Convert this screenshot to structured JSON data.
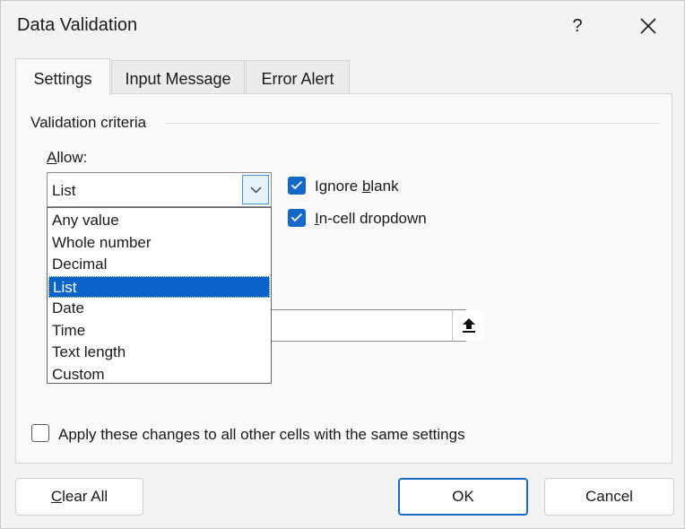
{
  "window": {
    "title": "Data Validation",
    "help_label": "?",
    "close_icon": "close-icon"
  },
  "tabs": [
    {
      "label": "Settings",
      "active": true
    },
    {
      "label": "Input Message",
      "active": false
    },
    {
      "label": "Error Alert",
      "active": false
    }
  ],
  "settings": {
    "group_label": "Validation criteria",
    "allow_label_underlined": "A",
    "allow_label_rest": "llow:",
    "allow_selected": "List",
    "allow_options": [
      "Any value",
      "Whole number",
      "Decimal",
      "List",
      "Date",
      "Time",
      "Text length",
      "Custom"
    ],
    "ignore_blank": {
      "pre": "Ignore ",
      "underlined": "b",
      "post": "lank",
      "checked": true
    },
    "incell_dropdown": {
      "pre": "",
      "underlined": "I",
      "post": "n-cell dropdown",
      "checked": true
    },
    "source_value": "",
    "range_icon": "collapse-dialog-icon",
    "apply_all": {
      "pre": "Apply these changes to all other cells with the same settings",
      "checked": false
    }
  },
  "buttons": {
    "clear_all_underlined": "C",
    "clear_all_rest": "lear All",
    "ok": "OK",
    "cancel": "Cancel"
  },
  "colors": {
    "accent": "#1469c8",
    "selection": "#0a64c8",
    "background": "#f3f3f3"
  }
}
